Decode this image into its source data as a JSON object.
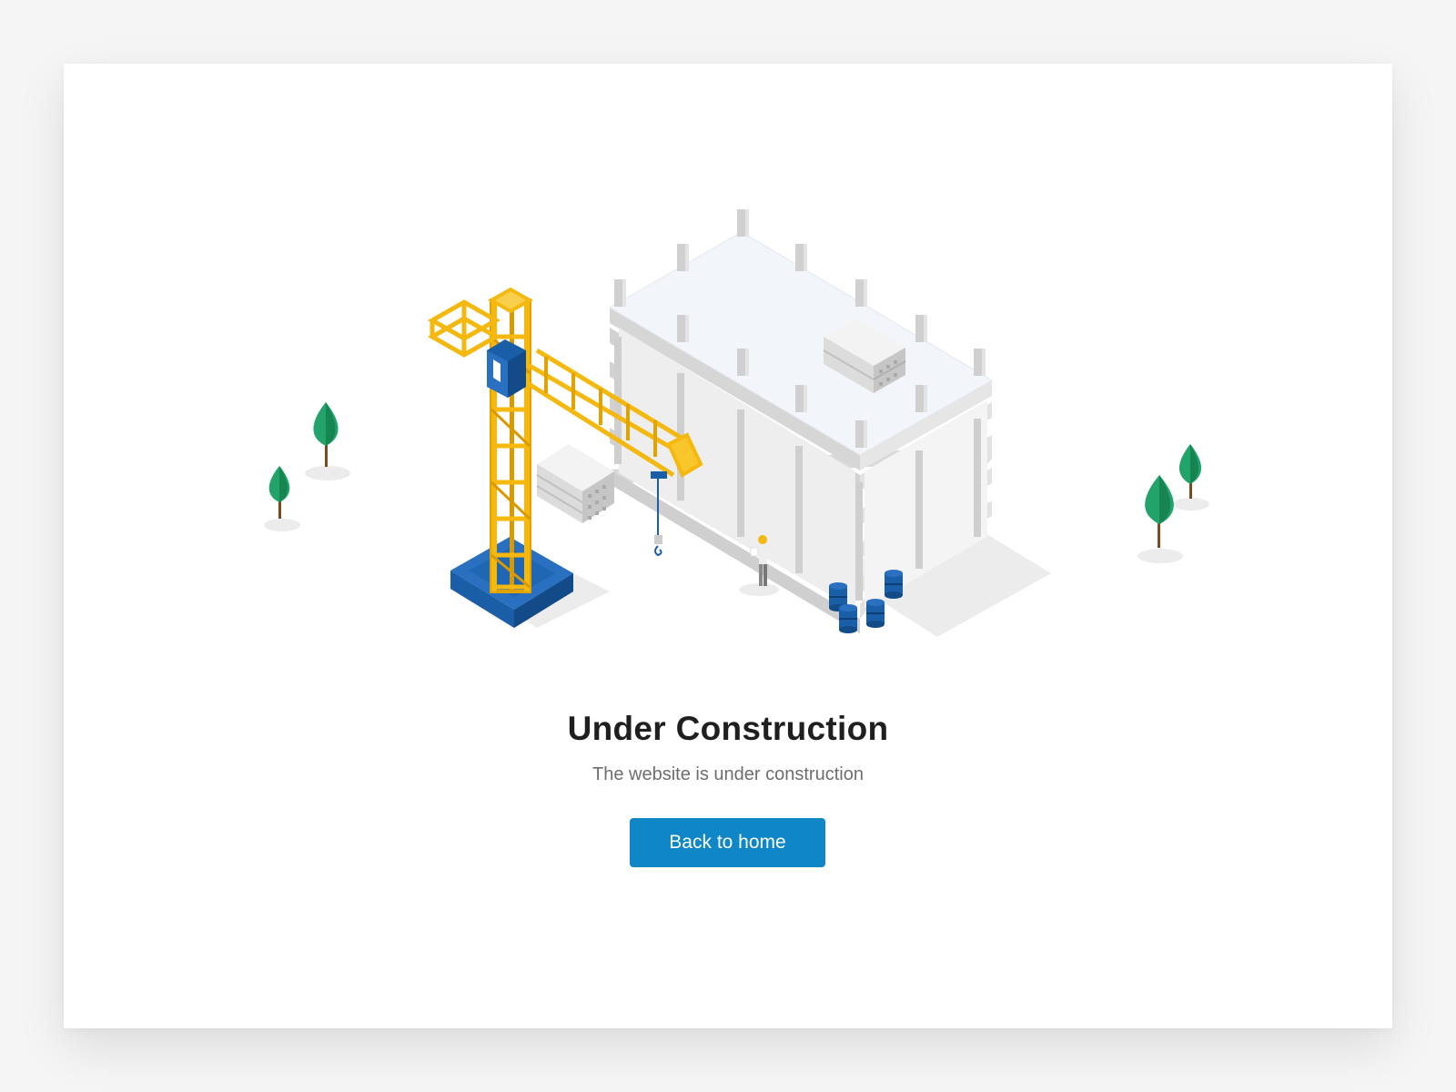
{
  "page": {
    "title": "Under Construction",
    "subtitle": "The website is under construction",
    "button_label": "Back to home"
  },
  "illustration": {
    "icons": [
      "crane-icon",
      "building-icon",
      "tree-icon",
      "worker-icon",
      "barrel-icon",
      "concrete-block-icon"
    ],
    "colors": {
      "crane": "#f5b80f",
      "crane_dark": "#d99a00",
      "base": "#1a5ea8",
      "tree": "#21a36a",
      "tree_dark": "#168552",
      "building": "#ececec",
      "slab": "#f2f6fa",
      "button": "#0f87c7"
    }
  }
}
